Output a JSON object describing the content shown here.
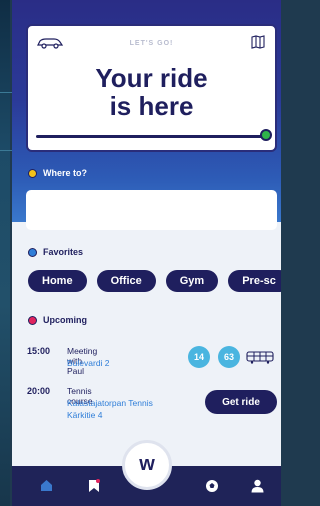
{
  "hero": {
    "subtitle": "LET'S GO!",
    "title": "Your ride\nis here",
    "progress": 1.0
  },
  "destination": {
    "label": "Where to?",
    "value": "",
    "placeholder": ""
  },
  "favorites": {
    "label": "Favorites",
    "items": [
      "Home",
      "Office",
      "Gym",
      "Pre-sc"
    ]
  },
  "upcoming": {
    "label": "Upcoming",
    "events": [
      {
        "time": "15:00",
        "title": "Meeting with Paul",
        "location": "Bulevardi 2",
        "bus_lines": [
          "14",
          "63"
        ]
      },
      {
        "time": "20:00",
        "title": "Tennis course",
        "location": "Kalastajatorpan Tennis Kärkitie 4",
        "action": "Get ride"
      }
    ]
  },
  "nav": {
    "items": [
      "home-icon",
      "bookmark-icon",
      "logo-w",
      "football-icon",
      "profile-icon"
    ],
    "logo_text": "w"
  },
  "colors": {
    "primary": "#1f1f5e",
    "accent_green": "#2fb34a",
    "accent_yellow": "#f2c21a",
    "accent_blue": "#2f7ed8",
    "accent_red": "#e0245e",
    "bus": "#4ab5e0"
  }
}
